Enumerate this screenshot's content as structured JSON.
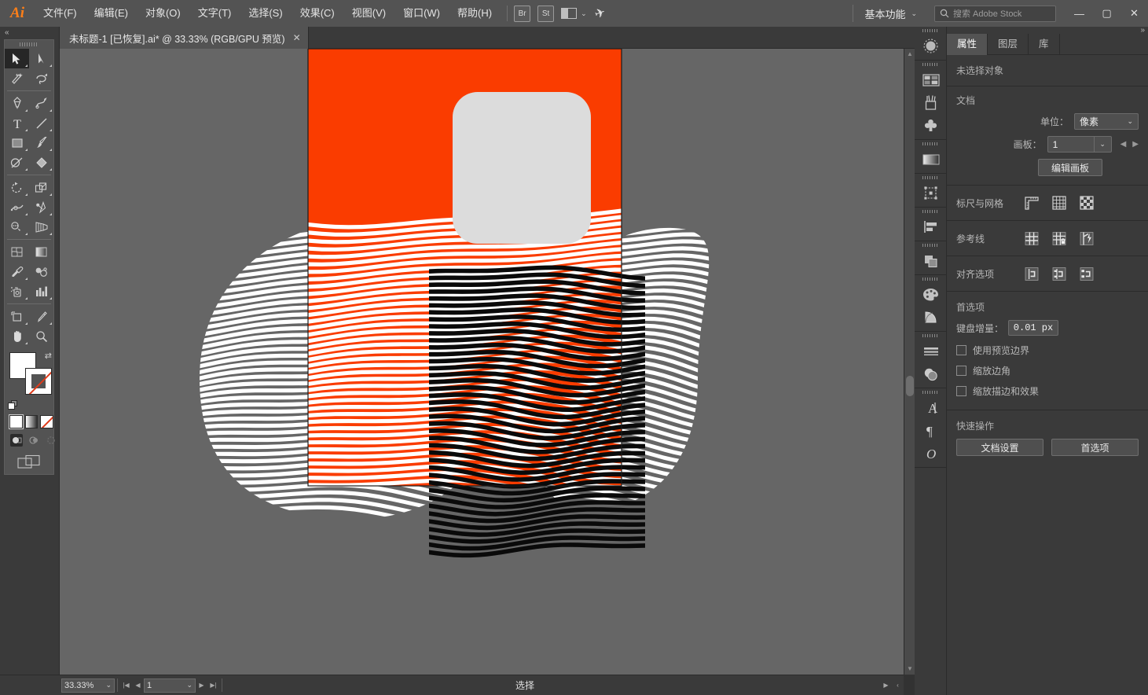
{
  "app": {
    "name": "Ai",
    "logo_text": "Ai"
  },
  "menubar": {
    "items": [
      {
        "label": "文件(F)",
        "name": "menu-file"
      },
      {
        "label": "编辑(E)",
        "name": "menu-edit"
      },
      {
        "label": "对象(O)",
        "name": "menu-object"
      },
      {
        "label": "文字(T)",
        "name": "menu-type"
      },
      {
        "label": "选择(S)",
        "name": "menu-select"
      },
      {
        "label": "效果(C)",
        "name": "menu-effect"
      },
      {
        "label": "视图(V)",
        "name": "menu-view"
      },
      {
        "label": "窗口(W)",
        "name": "menu-window"
      },
      {
        "label": "帮助(H)",
        "name": "menu-help"
      }
    ],
    "bridge_label": "Br",
    "stock_label": "St",
    "workspace": "基本功能",
    "search_placeholder": "搜索 Adobe Stock",
    "window_minimize": "—",
    "window_maximize": "▢",
    "window_close": "✕"
  },
  "tabbar": {
    "document_title": "未标题-1  [已恢复].ai* @ 33.33% (RGB/GPU 预览)",
    "close_glyph": "✕",
    "collapse_glyph": "»"
  },
  "toolbar": {
    "collapse_glyph": "«",
    "tools": [
      {
        "name": "selection-tool",
        "label": "选择工具",
        "active": true
      },
      {
        "name": "direct-selection-tool",
        "label": "直接选择工具",
        "active": false
      },
      {
        "name": "magic-wand-tool",
        "label": "魔棒工具",
        "active": false
      },
      {
        "name": "lasso-tool",
        "label": "套索工具",
        "active": false
      },
      {
        "name": "pen-tool",
        "label": "钢笔工具",
        "active": false
      },
      {
        "name": "curvature-tool",
        "label": "曲率工具",
        "active": false
      },
      {
        "name": "type-tool",
        "label": "文字工具",
        "active": false
      },
      {
        "name": "line-segment-tool",
        "label": "直线段工具",
        "active": false
      },
      {
        "name": "rectangle-tool",
        "label": "矩形工具",
        "active": false
      },
      {
        "name": "paintbrush-tool",
        "label": "画笔工具",
        "active": false
      },
      {
        "name": "shaper-tool",
        "label": "Shaper 工具",
        "active": false
      },
      {
        "name": "eraser-tool",
        "label": "橡皮擦工具",
        "active": false
      },
      {
        "name": "rotate-tool",
        "label": "旋转工具",
        "active": false
      },
      {
        "name": "scale-tool",
        "label": "比例缩放工具",
        "active": false
      },
      {
        "name": "width-tool",
        "label": "宽度工具",
        "active": false
      },
      {
        "name": "free-transform-tool",
        "label": "自由变换工具",
        "active": false
      },
      {
        "name": "shape-builder-tool",
        "label": "形状生成器工具",
        "active": false
      },
      {
        "name": "perspective-grid-tool",
        "label": "透视网格工具",
        "active": false
      },
      {
        "name": "mesh-tool",
        "label": "网格工具",
        "active": false
      },
      {
        "name": "gradient-tool",
        "label": "渐变工具",
        "active": false
      },
      {
        "name": "eyedropper-tool",
        "label": "吸管工具",
        "active": false
      },
      {
        "name": "blend-tool",
        "label": "混合工具",
        "active": false
      },
      {
        "name": "symbol-sprayer-tool",
        "label": "符号喷枪工具",
        "active": false
      },
      {
        "name": "column-graph-tool",
        "label": "柱形图工具",
        "active": false
      },
      {
        "name": "artboard-tool",
        "label": "画板工具",
        "active": false
      },
      {
        "name": "slice-tool",
        "label": "切片工具",
        "active": false
      },
      {
        "name": "hand-tool",
        "label": "抓手工具",
        "active": false
      },
      {
        "name": "zoom-tool",
        "label": "缩放工具",
        "active": false
      }
    ],
    "fill_color": "#ffffff",
    "stroke_color": "none",
    "swap_glyph": "⇄",
    "color_modes": [
      {
        "name": "color-mode-flat",
        "selected": true
      },
      {
        "name": "color-mode-gradient",
        "selected": false
      },
      {
        "name": "color-mode-none",
        "selected": false
      }
    ],
    "draw_modes": [
      {
        "name": "draw-normal-mode",
        "selected": true
      },
      {
        "name": "draw-behind-mode",
        "selected": false
      },
      {
        "name": "draw-inside-mode",
        "selected": false
      }
    ],
    "screen_mode_name": "screen-mode-button"
  },
  "canvas": {
    "artboard_fill": "#fa3c00",
    "canvas_bg": "#666666",
    "hole_fill": "#dcdcdc",
    "stripe_white": "#ffffff",
    "stripe_black": "#0a0a0a",
    "artboard_border": "#1b1b1b"
  },
  "statusbar": {
    "zoom_level": "33.33%",
    "zoom_dropdown_glyph": "⌄",
    "first_page_glyph": "|◀",
    "prev_page_glyph": "◀",
    "page_number": "1",
    "page_dropdown_glyph": "⌄",
    "next_page_glyph": "▶",
    "last_page_glyph": "▶|",
    "status_text": "选择",
    "play_glyph": "▶",
    "back_glyph": "‹",
    "hscroll_right_glyph": "›"
  },
  "panel_rail": {
    "groups": [
      {
        "items": [
          {
            "name": "stock-libraries-icon",
            "label": "Adobe Stock"
          }
        ]
      },
      {
        "items": [
          {
            "name": "artboards-icon",
            "label": "画板"
          },
          {
            "name": "brushes-icon",
            "label": "画笔"
          },
          {
            "name": "symbols-icon",
            "label": "符号"
          }
        ]
      },
      {
        "items": [
          {
            "name": "gradient-panel-icon",
            "label": "渐变"
          }
        ]
      },
      {
        "items": [
          {
            "name": "transform-panel-icon",
            "label": "变换"
          }
        ]
      },
      {
        "items": [
          {
            "name": "align-panel-icon",
            "label": "对齐"
          }
        ]
      },
      {
        "items": [
          {
            "name": "pathfinder-panel-icon",
            "label": "路径查找器"
          }
        ]
      },
      {
        "items": [
          {
            "name": "color-panel-icon",
            "label": "颜色"
          },
          {
            "name": "color-guide-icon",
            "label": "颜色参考"
          }
        ]
      },
      {
        "items": [
          {
            "name": "stroke-panel-icon",
            "label": "描边"
          },
          {
            "name": "transparency-panel-icon",
            "label": "透明度"
          }
        ]
      },
      {
        "items": [
          {
            "name": "character-panel-icon",
            "label": "字符"
          },
          {
            "name": "paragraph-panel-icon",
            "label": "段落"
          },
          {
            "name": "glyphs-panel-icon",
            "label": "字形"
          }
        ]
      }
    ]
  },
  "panel": {
    "collapse_glyph": "»",
    "tabs": [
      {
        "label": "属性",
        "name": "tab-properties",
        "active": true
      },
      {
        "label": "图层",
        "name": "tab-layers",
        "active": false
      },
      {
        "label": "库",
        "name": "tab-libraries",
        "active": false
      }
    ],
    "selection_status": "未选择对象",
    "document": {
      "title": "文档",
      "units_label": "单位：",
      "units_value": "像素",
      "artboard_label": "画板：",
      "artboard_value": "1",
      "edit_artboards_label": "编辑画板",
      "prev_glyph": "◀",
      "next_glyph": "▶"
    },
    "rulers_grid": {
      "title": "标尺与网格",
      "icons": [
        {
          "name": "show-rulers-icon",
          "label": "显示标尺"
        },
        {
          "name": "show-grid-icon",
          "label": "显示网格"
        },
        {
          "name": "show-transparency-grid-icon",
          "label": "显示透明度网格"
        }
      ]
    },
    "guides": {
      "title": "参考线",
      "icons": [
        {
          "name": "show-guides-icon",
          "label": "显示参考线"
        },
        {
          "name": "lock-guides-icon",
          "label": "锁定参考线"
        },
        {
          "name": "smart-guides-icon",
          "label": "智能参考线"
        }
      ]
    },
    "align_options": {
      "title": "对齐选项",
      "icons": [
        {
          "name": "align-to-artboard-icon",
          "label": "对齐画板"
        },
        {
          "name": "align-to-key-object-icon",
          "label": "对齐关键对象"
        },
        {
          "name": "align-to-selection-icon",
          "label": "对齐所选对象"
        }
      ]
    },
    "preferences": {
      "title": "首选项",
      "keyboard_increment_label": "键盘增量：",
      "keyboard_increment_value": "0.01 px",
      "checkboxes": [
        {
          "label": "使用预览边界",
          "name": "use-preview-bounds-checkbox",
          "checked": false
        },
        {
          "label": "缩放边角",
          "name": "scale-corners-checkbox",
          "checked": false
        },
        {
          "label": "缩放描边和效果",
          "name": "scale-strokes-effects-checkbox",
          "checked": false
        }
      ]
    },
    "quick_actions": {
      "title": "快速操作",
      "buttons": [
        {
          "label": "文档设置",
          "name": "document-setup-button"
        },
        {
          "label": "首选项",
          "name": "preferences-button"
        }
      ]
    }
  }
}
